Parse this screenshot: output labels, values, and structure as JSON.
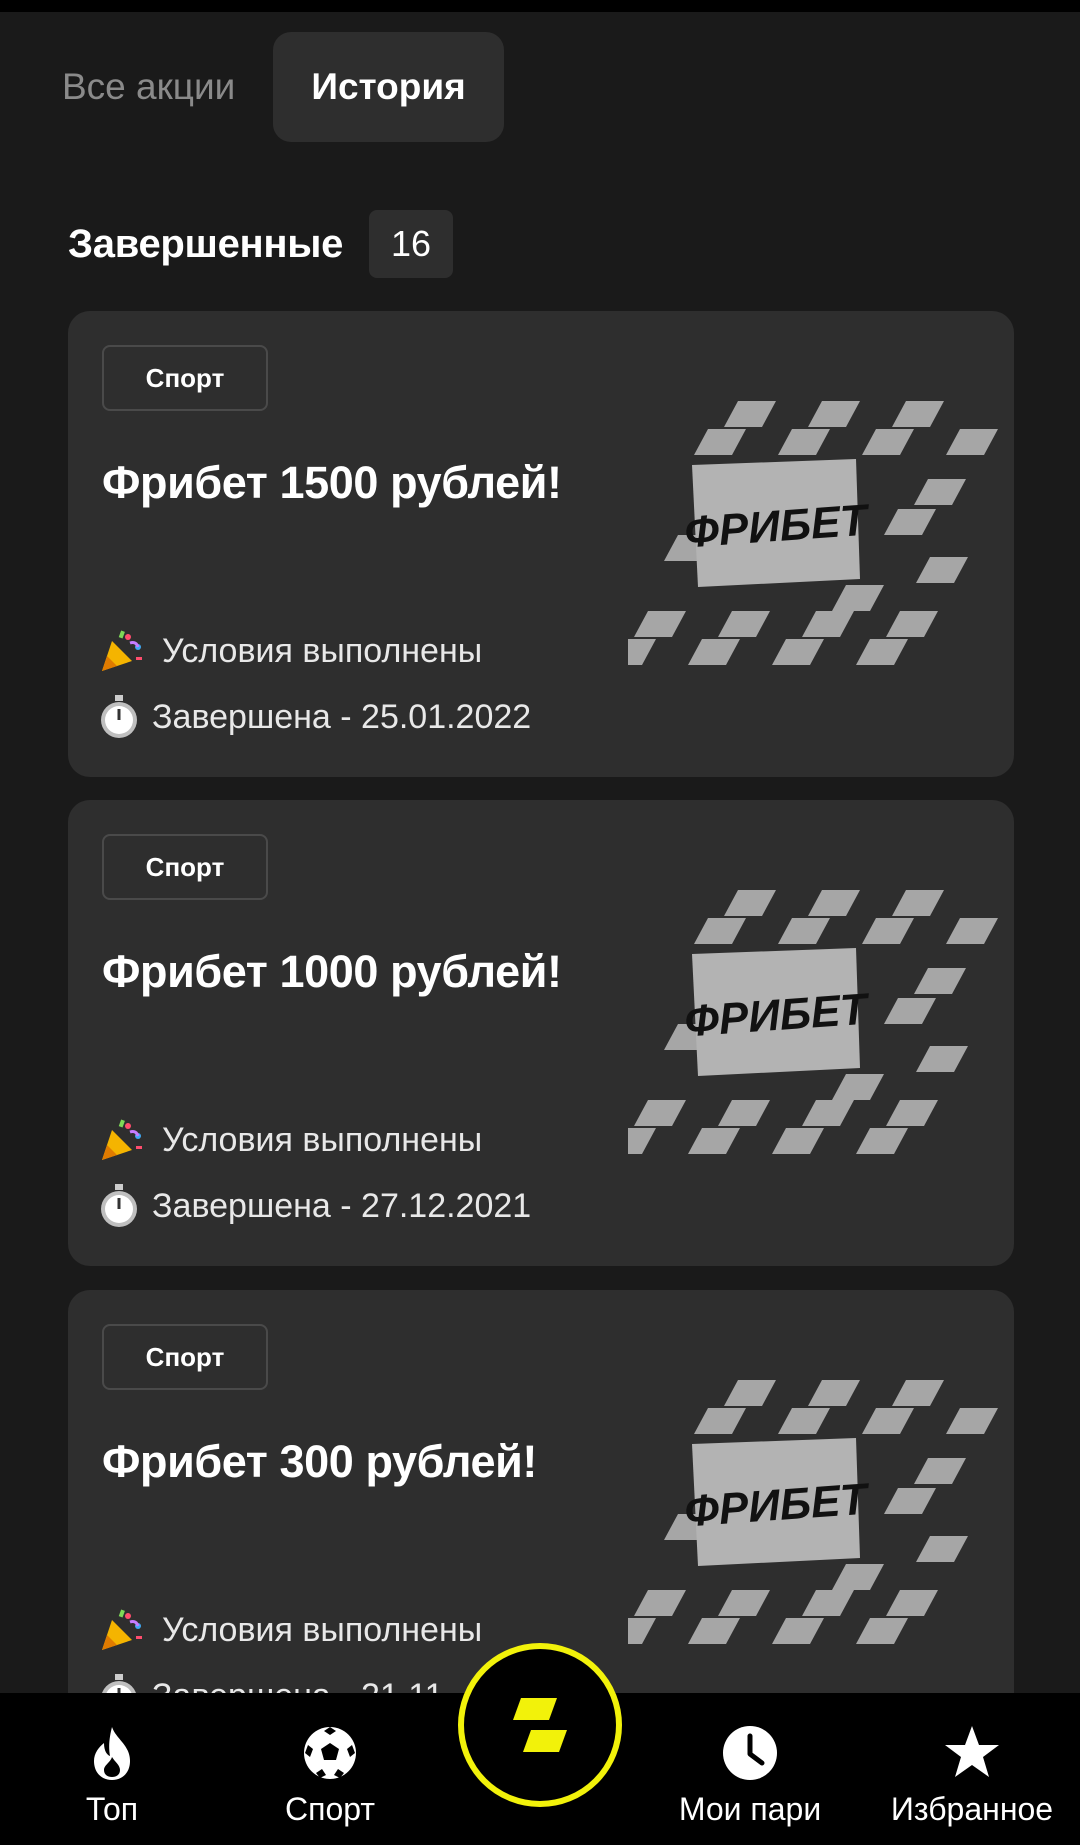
{
  "tabs": [
    {
      "label": "Все акции",
      "active": false
    },
    {
      "label": "История",
      "active": true
    }
  ],
  "section": {
    "title": "Завершенные",
    "count": "16"
  },
  "cards": [
    {
      "category": "Спорт",
      "title": "Фрибет 1500 рублей!",
      "status": "Условия выполнены",
      "ended": "Завершена - 25.01.2022",
      "art_label": "ФРИБЕТ"
    },
    {
      "category": "Спорт",
      "title": "Фрибет 1000 рублей!",
      "status": "Условия выполнены",
      "ended": "Завершена - 27.12.2021",
      "art_label": "ФРИБЕТ"
    },
    {
      "category": "Спорт",
      "title": "Фрибет 300 рублей!",
      "status": "Условия выполнены",
      "ended": "Завершена - 21.11",
      "art_label": "ФРИБЕТ"
    }
  ],
  "bottom_nav": {
    "items": [
      {
        "label": "Топ",
        "icon": "flame-icon"
      },
      {
        "label": "Спорт",
        "icon": "soccer-ball-icon"
      },
      {
        "label": "Мои пари",
        "icon": "clock-icon"
      },
      {
        "label": "Избранное",
        "icon": "star-icon"
      }
    ],
    "center_icon": "brand-logo-icon",
    "accent_color": "#f2f20a"
  },
  "colors": {
    "background": "#1a1a1a",
    "card": "#2e2e2e",
    "accent": "#f2f20a"
  }
}
